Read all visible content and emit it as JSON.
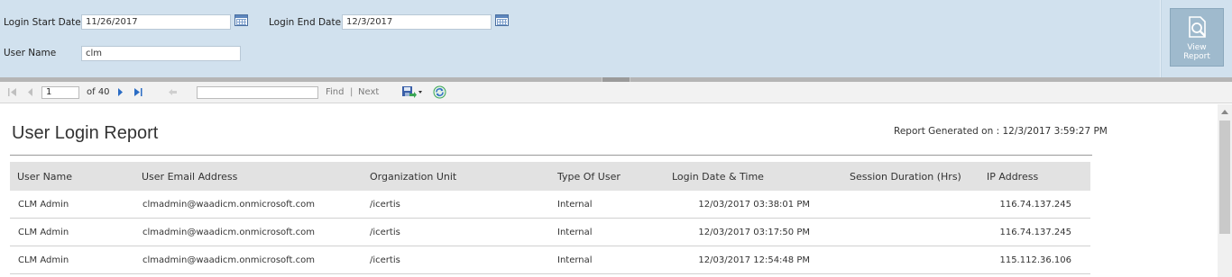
{
  "params": {
    "start_label": "Login Start Date",
    "start_value": "11/26/2017",
    "end_label": "Login End Date",
    "end_value": "12/3/2017",
    "user_label": "User Name",
    "user_value": "clm",
    "view_report_line1": "View",
    "view_report_line2": "Report"
  },
  "toolbar": {
    "page_value": "1",
    "of_pages": "of 40",
    "find_value": "",
    "find_label": "Find",
    "separator": "|",
    "next_label": "Next"
  },
  "report": {
    "title": "User Login Report",
    "generated": "Report Generated on : 12/3/2017 3:59:27 PM",
    "columns": [
      "User Name",
      "User Email Address",
      "Organization Unit",
      "Type Of User",
      "Login Date & Time",
      "Session Duration (Hrs)",
      "IP Address"
    ],
    "rows": [
      [
        "CLM Admin",
        "clmadmin@waadicm.onmicrosoft.com",
        "/icertis",
        "Internal",
        "12/03/2017 03:38:01 PM",
        "",
        "116.74.137.245"
      ],
      [
        "CLM Admin",
        "clmadmin@waadicm.onmicrosoft.com",
        "/icertis",
        "Internal",
        "12/03/2017 03:17:50 PM",
        "",
        "116.74.137.245"
      ],
      [
        "CLM Admin",
        "clmadmin@waadicm.onmicrosoft.com",
        "/icertis",
        "Internal",
        "12/03/2017 12:54:48 PM",
        "",
        "115.112.36.106"
      ]
    ]
  },
  "colors": {
    "param_bg": "#d1e1ee",
    "toolbar_bg": "#f2f2f2",
    "header_bg": "#e2e2e2",
    "accent_blue": "#2b6cc4",
    "refresh_green": "#3aa655"
  },
  "icons": [
    "calendar-icon",
    "first-page-icon",
    "previous-page-icon",
    "next-page-icon",
    "last-page-icon",
    "back-icon",
    "export-icon",
    "refresh-icon",
    "view-report-icon"
  ]
}
